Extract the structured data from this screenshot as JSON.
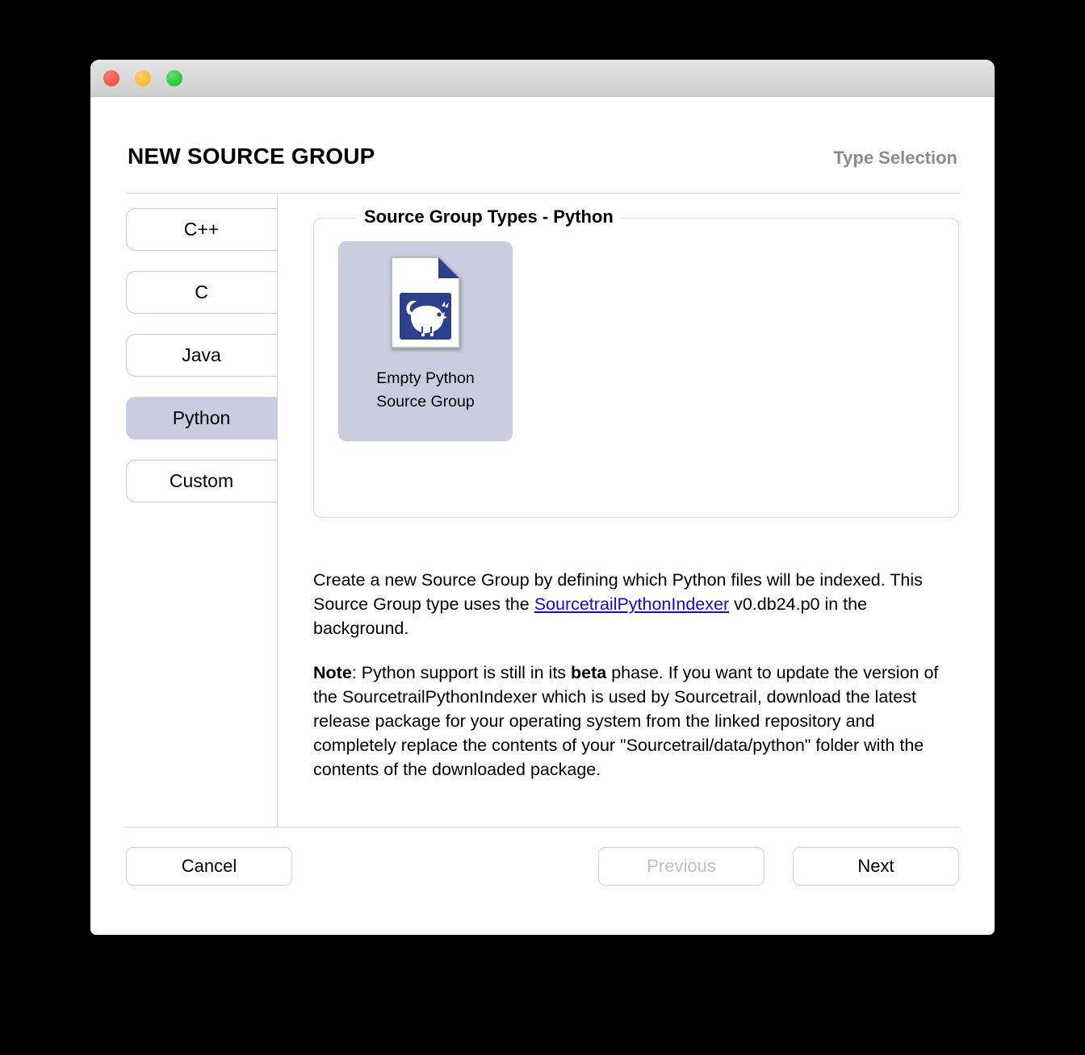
{
  "window": {
    "traffic_lights": [
      {
        "name": "close-button",
        "color": "#f35448"
      },
      {
        "name": "minimize-button",
        "color": "#f9ba32"
      },
      {
        "name": "zoom-button",
        "color": "#28c53c"
      }
    ]
  },
  "header": {
    "title": "NEW SOURCE GROUP",
    "step": "Type Selection"
  },
  "sidebar": {
    "items": [
      {
        "label": "C++",
        "selected": false
      },
      {
        "label": "C",
        "selected": false
      },
      {
        "label": "Java",
        "selected": false
      },
      {
        "label": "Python",
        "selected": true
      },
      {
        "label": "Custom",
        "selected": false
      }
    ]
  },
  "groupbox": {
    "legend": "Source Group Types - Python",
    "tiles": [
      {
        "icon": "python-source-file-icon",
        "label_line1": "Empty Python",
        "label_line2": "Source Group",
        "selected": true
      }
    ]
  },
  "description": {
    "paragraph1": {
      "before_link": "Create a new Source Group by defining which Python files will be indexed. This Source Group type uses the ",
      "link_text": "SourcetrailPythonIndexer",
      "after_link": " v0.db24.p0 in the background."
    },
    "paragraph2": {
      "note_label": "Note",
      "part1": ": Python support is still in its ",
      "emphasis": "beta",
      "part2": " phase. If you want to update the version of the SourcetrailPythonIndexer which is used by Sourcetrail, download the latest release package for your operating system from the linked repository and completely replace the contents of your \"Sourcetrail/data/python\" folder with the contents of the downloaded package."
    }
  },
  "footer": {
    "cancel_label": "Cancel",
    "previous_label": "Previous",
    "next_label": "Next"
  },
  "colors": {
    "selection": "#c9cddf",
    "link": "#1208ef",
    "muted_text": "#8c8c8c",
    "disabled_text": "#c0c0c0",
    "icon_blue": "#2f3f8f"
  }
}
